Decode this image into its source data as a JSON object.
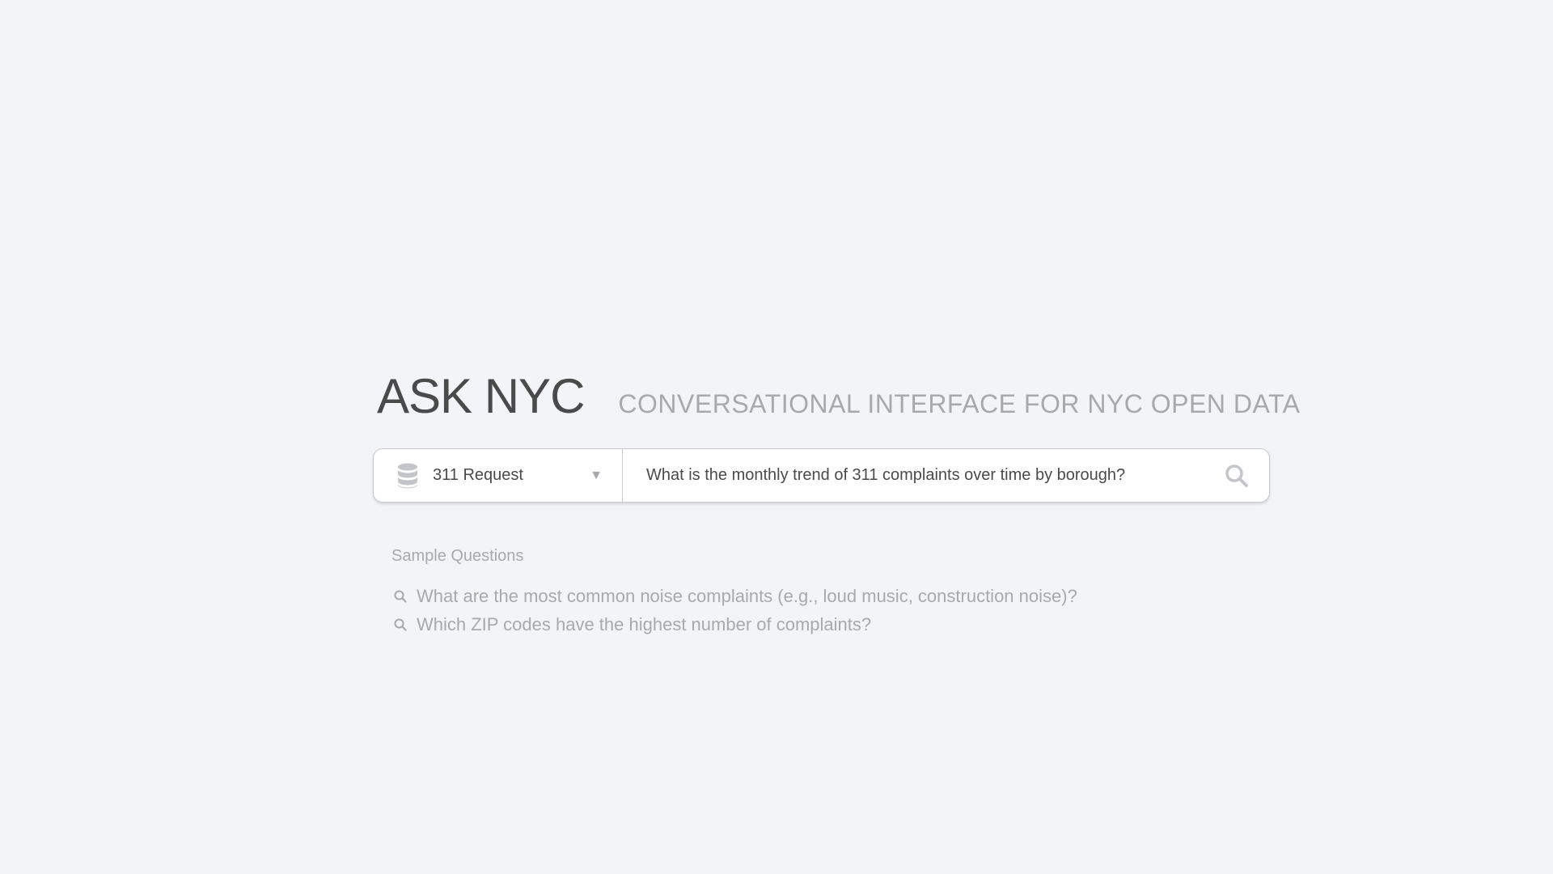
{
  "header": {
    "title": "ASK NYC",
    "subtitle": "CONVERSATIONAL INTERFACE FOR NYC OPEN DATA"
  },
  "search": {
    "dataset_icon": "database-icon",
    "dataset_selected": "311 Request",
    "dataset_caret_icon": "caret-down-icon",
    "query_value": "What is the monthly trend of 311 complaints over time by borough?",
    "search_icon": "search-icon"
  },
  "samples": {
    "heading": "Sample Questions",
    "items": [
      {
        "icon": "search-icon",
        "text": "What are the most common noise complaints (e.g., loud music, construction noise)?"
      },
      {
        "icon": "search-icon",
        "text": "Which ZIP codes have the highest number of complaints?"
      }
    ]
  },
  "colors": {
    "background": "#f3f4f7",
    "title": "#4a4a4a",
    "muted": "#a7a9ad",
    "border": "#c9cacd"
  }
}
